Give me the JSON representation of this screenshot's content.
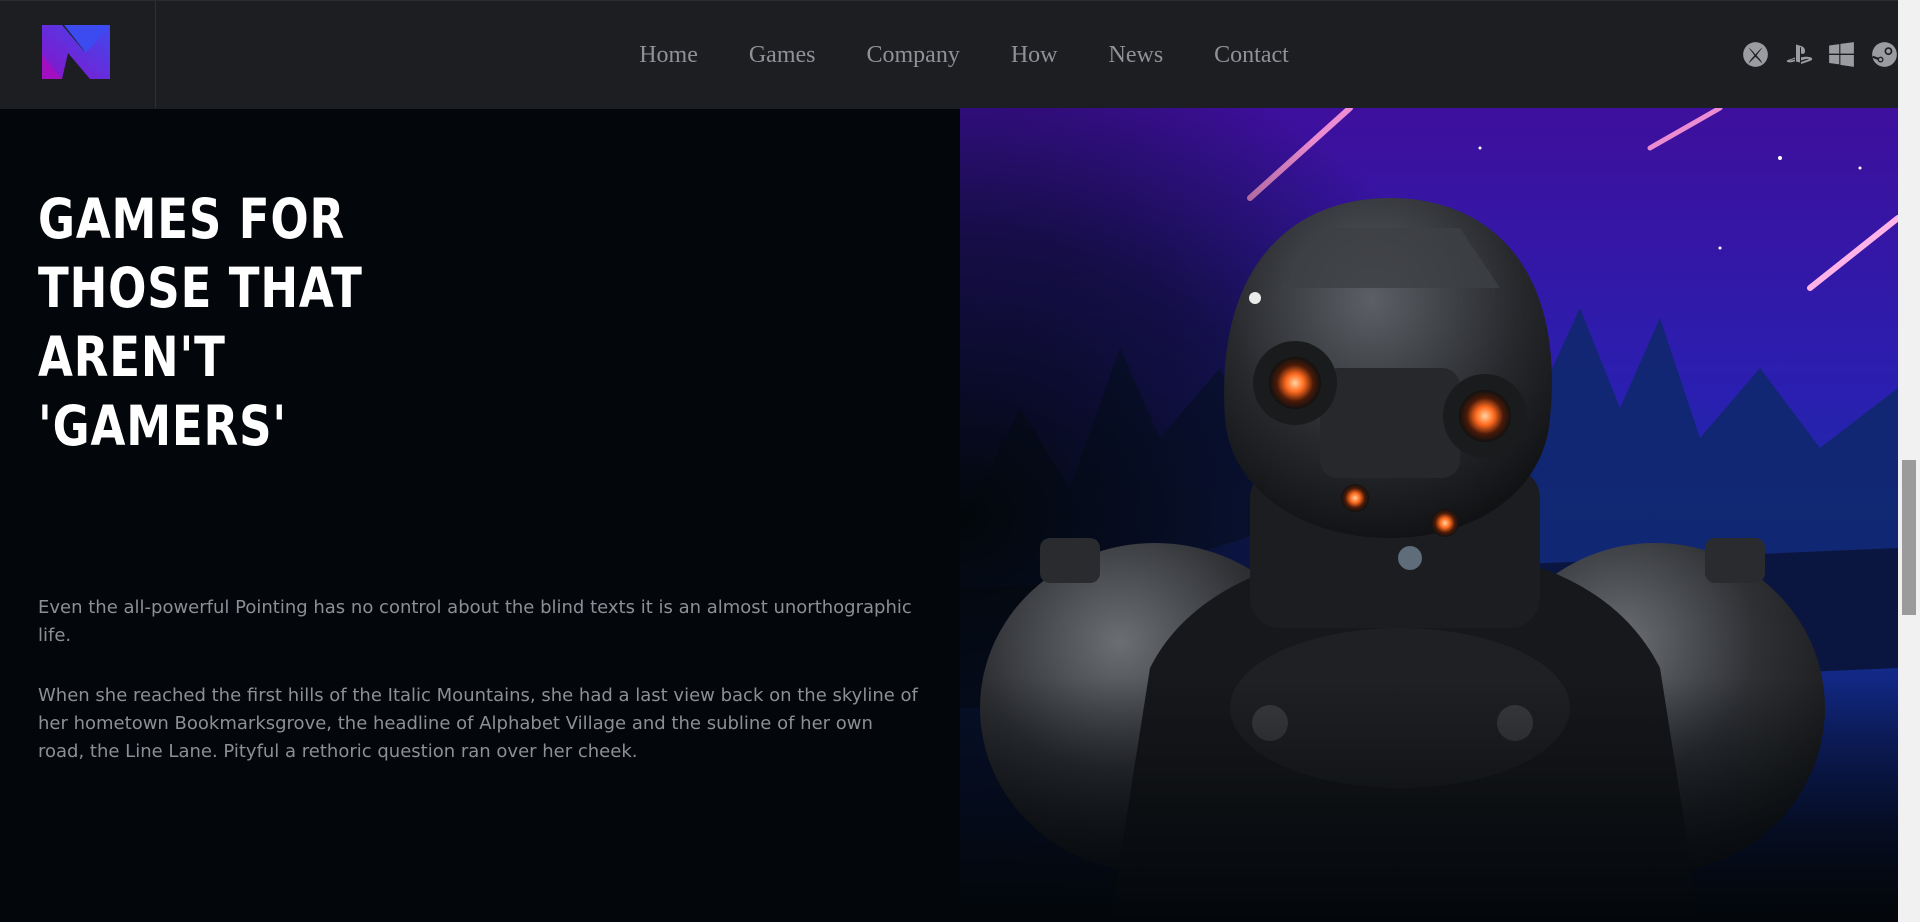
{
  "nav": {
    "items": [
      "Home",
      "Games",
      "Company",
      "How",
      "News",
      "Contact"
    ]
  },
  "platform_icons": [
    "xbox-icon",
    "playstation-icon",
    "windows-icon",
    "steam-icon"
  ],
  "hero": {
    "title_lines": [
      "GAMES FOR",
      "THOSE THAT",
      "AREN'T",
      "'GAMERS'"
    ],
    "paragraph1": "Even the all-powerful Pointing has no control about the blind texts it is an almost unorthographic life.",
    "paragraph2": "When she reached the first hills of the Italic Mountains, she had a last view back on the skyline of her hometown Bookmarksgrove, the headline of Alphabet Village and the subline of her own road, the Line Lane. Pityful a rethoric question ran over her cheek."
  },
  "colors": {
    "nav_bg": "#1d1e22",
    "page_bg": "#03070b",
    "accent_purple": "#7a1fd8",
    "accent_blue": "#3b49e8"
  }
}
